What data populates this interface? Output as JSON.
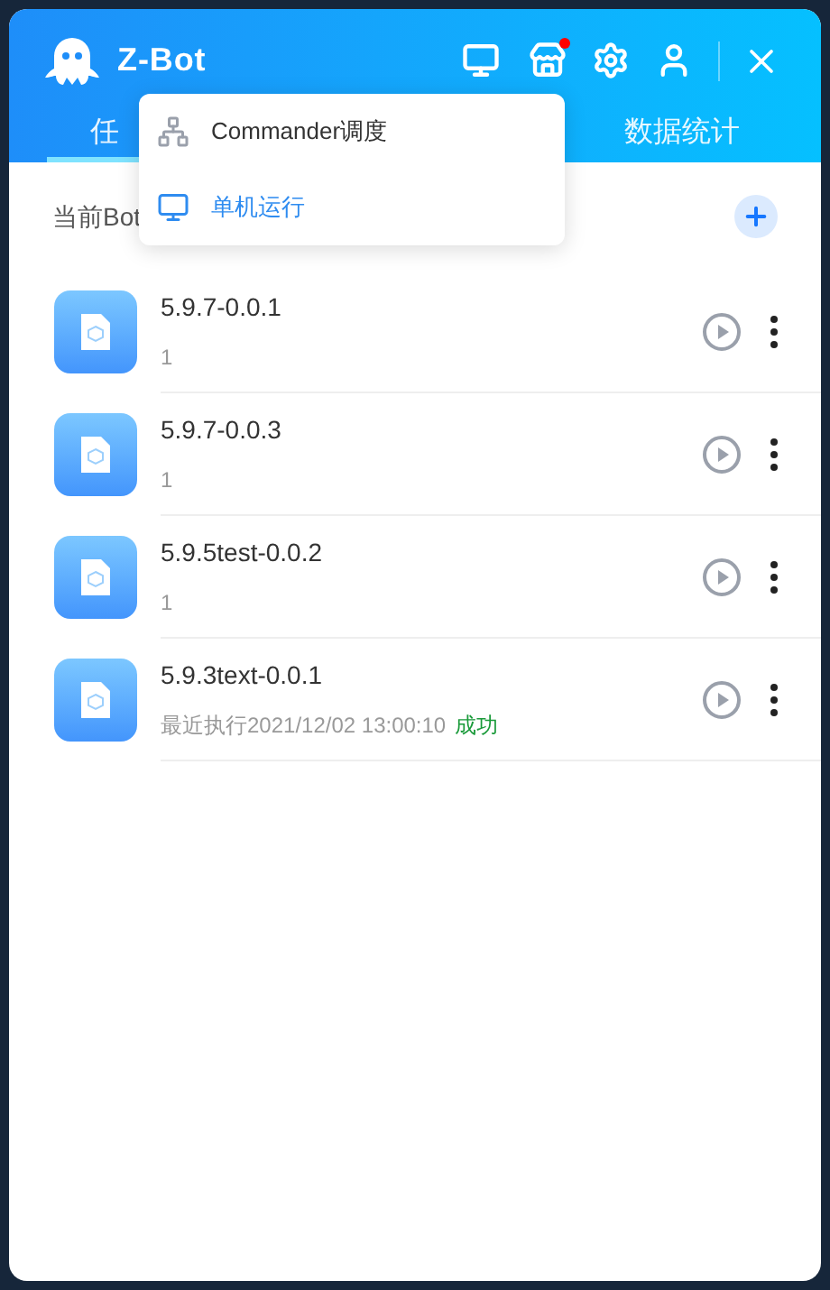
{
  "app": {
    "title": "Z-Bot",
    "notification_dot": true
  },
  "tabs": [
    {
      "label": "任",
      "selected": true
    },
    {
      "label": "数据统计",
      "selected": false
    }
  ],
  "dropdown": [
    {
      "label": "Commander调度",
      "selected": false
    },
    {
      "label": "单机运行",
      "selected": true
    }
  ],
  "section": {
    "title": "当前Bot"
  },
  "tasks": [
    {
      "name": "5.9.7-0.0.1",
      "detail": "1"
    },
    {
      "name": "5.9.7-0.0.3",
      "detail": "1"
    },
    {
      "name": "5.9.5test-0.0.2",
      "detail": "1"
    },
    {
      "name": "5.9.3text-0.0.1",
      "detail": "最近执行2021/12/02 13:00:10",
      "status": "成功"
    }
  ]
}
